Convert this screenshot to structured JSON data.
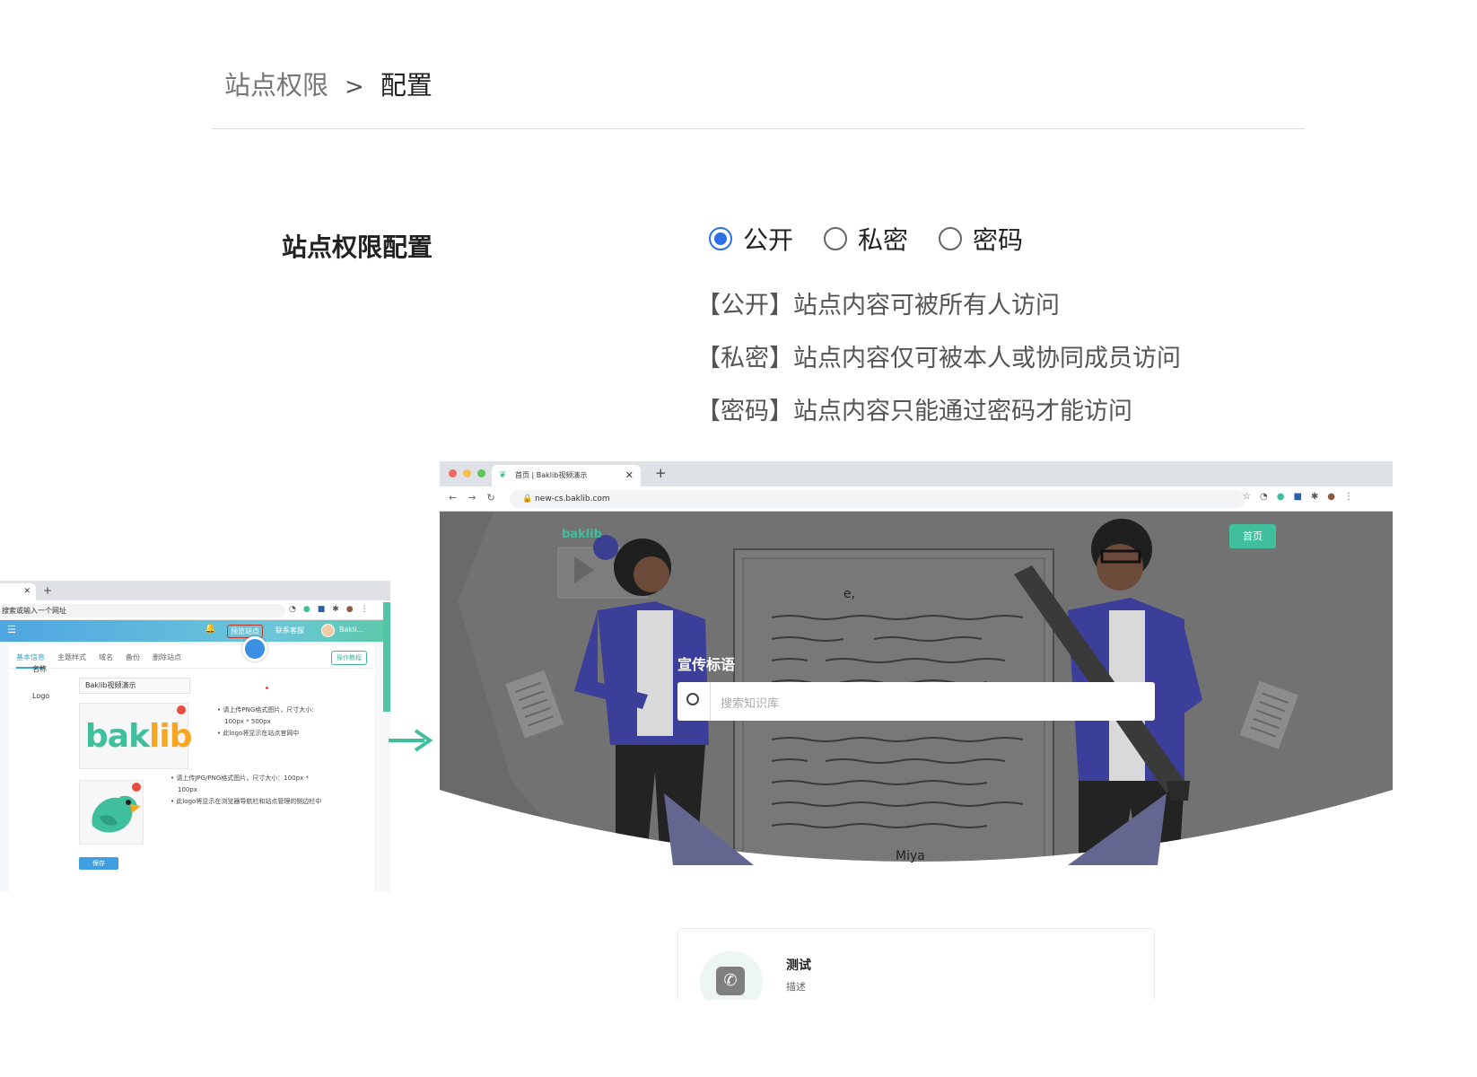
{
  "breadcrumb": {
    "parent": "站点权限",
    "separator": ">",
    "current": "配置"
  },
  "config": {
    "title": "站点权限配置",
    "options": [
      {
        "label": "公开",
        "selected": true
      },
      {
        "label": "私密",
        "selected": false
      },
      {
        "label": "密码",
        "selected": false
      }
    ],
    "descriptions": [
      "【公开】站点内容可被所有人访问",
      "【私密】站点内容仅可被本人或协同成员访问",
      "【密码】站点内容只能通过密码才能访问"
    ]
  },
  "admin_shot": {
    "url_placeholder": "搜索或输入一个网址",
    "header": {
      "preview": "预览站点",
      "contact": "联系客服",
      "user": "Bakli..."
    },
    "nav": [
      "基本信息",
      "主题样式",
      "域名",
      "备份",
      "删除站点"
    ],
    "guide_button": "操作教程",
    "name_label": "名称",
    "name_value": "Baklib视频演示",
    "logo_label": "Logo",
    "logo_word_a": "bak",
    "logo_word_b": "lib",
    "logo_notes": [
      "请上传PNG格式图片，尺寸大小:",
      "100px * 500px",
      "此logo将显示在站点官网中"
    ],
    "icon_notes": [
      "请上传JPG/PNG格式图片，尺寸大小：100px *",
      "100px",
      "此logo将显示在浏览器导航栏和站点管理的侧边栏中"
    ],
    "save_button": "保存"
  },
  "site_shot": {
    "tab_title": "首页 | Baklib视频演示",
    "url": "new-cs.baklib.com",
    "logo": "baklib",
    "home_button": "首页",
    "slogan": "宣传标语",
    "search_placeholder": "搜索知识库",
    "illustration_sign": "Miya",
    "doc_letter": "e,",
    "card": {
      "title": "测试",
      "desc": "描述"
    }
  },
  "colors": {
    "accent": "#2f6fe4",
    "brand_green": "#3fbf9b",
    "brand_orange": "#f5a623"
  }
}
